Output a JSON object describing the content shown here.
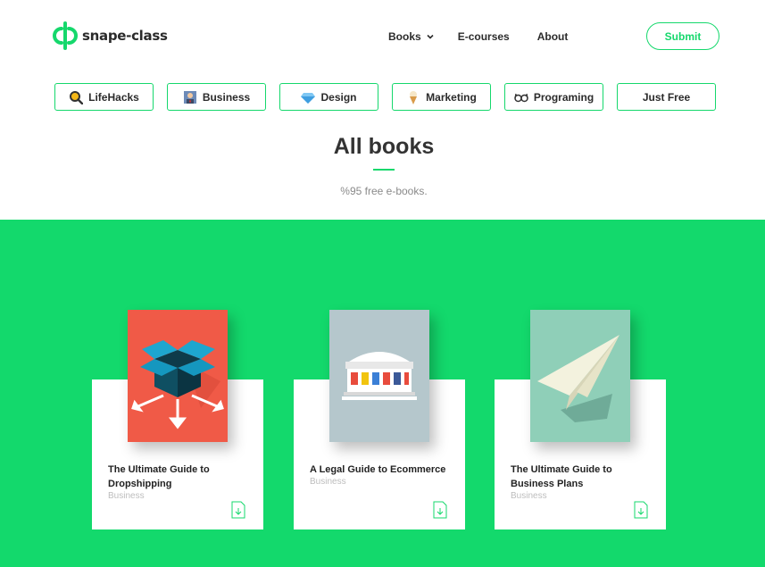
{
  "brand": {
    "name": "snape-class",
    "color": "#15d86c"
  },
  "nav": {
    "books": "Books",
    "ecourses": "E-courses",
    "about": "About"
  },
  "header": {
    "submit_label": "Submit"
  },
  "categories": [
    {
      "label": "LifeHacks",
      "icon": "magnifier-icon"
    },
    {
      "label": "Business",
      "icon": "businessman-icon"
    },
    {
      "label": "Design",
      "icon": "diamond-icon"
    },
    {
      "label": "Marketing",
      "icon": "ice-cream-icon"
    },
    {
      "label": "Programing",
      "icon": "glasses-icon"
    },
    {
      "label": "Just Free",
      "icon": ""
    }
  ],
  "section": {
    "title": "All books",
    "subtitle": "%95 free e-books."
  },
  "books": [
    {
      "title": "The Ultimate Guide to Dropshipping",
      "category": "Business",
      "cover_icon": "open-box-icon",
      "cover_color": "#f05a47"
    },
    {
      "title": "A Legal Guide to Ecommerce",
      "category": "Business",
      "cover_icon": "court-building-icon",
      "cover_color": "#b5c7cc"
    },
    {
      "title": "The Ultimate Guide to Business Plans",
      "category": "Business",
      "cover_icon": "paper-plane-icon",
      "cover_color": "#8fcfb8"
    }
  ]
}
